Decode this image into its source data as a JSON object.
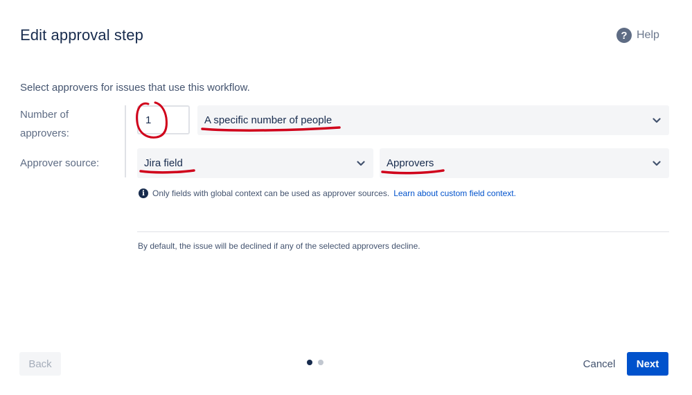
{
  "header": {
    "title": "Edit approval step",
    "help_label": "Help"
  },
  "intro": "Select approvers for issues that use this workflow.",
  "form": {
    "number_label_line1": "Number of",
    "number_label_line2": "approvers:",
    "number_value": "1",
    "number_mode": "A specific number of people",
    "source_label": "Approver source:",
    "source_type": "Jira field",
    "source_field": "Approvers"
  },
  "info": {
    "text": "Only fields with global context can be used as approver sources.",
    "link": "Learn about custom field context."
  },
  "note": "By default, the issue will be declined if any of the selected approvers decline.",
  "footer": {
    "back_label": "Back",
    "cancel_label": "Cancel",
    "next_label": "Next",
    "steps_total": 2,
    "steps_current": 1
  },
  "colors": {
    "primary": "#0052cc",
    "annotation": "#d0021b",
    "dot_active": "#172b4d",
    "dot_inactive": "#c1c7d0"
  },
  "icons": {
    "help": "question-circle-icon",
    "info": "info-circle-icon",
    "chevron": "chevron-down-icon"
  }
}
